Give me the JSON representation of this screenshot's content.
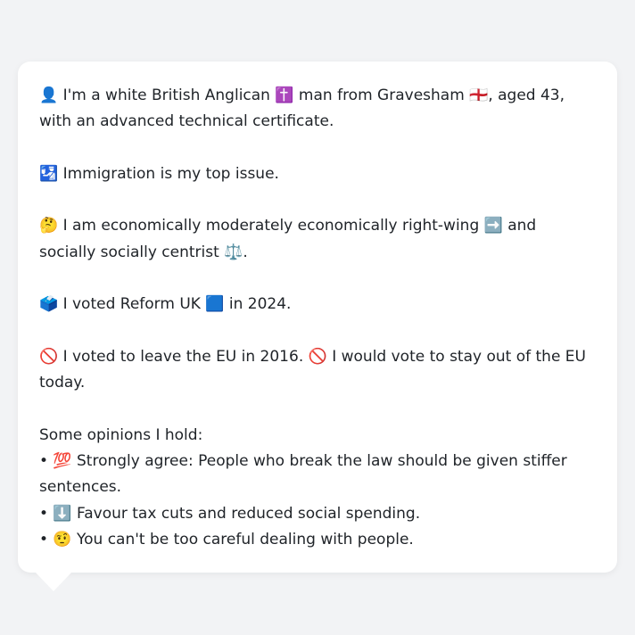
{
  "profile": {
    "identity": "👤 I'm a white British Anglican ✝️ man from Gravesham 🏴󠁧󠁢󠁥󠁮󠁧󠁿, aged 43, with an advanced technical certificate.",
    "top_issue": "🛂 Immigration is my top issue.",
    "ideology": "🤔 I am economically moderately economically right-wing ➡️ and socially socially centrist ⚖️.",
    "vote_2024": "🗳️ I voted Reform UK 🟦 in 2024.",
    "eu": "🚫 I voted to leave the EU in 2016. 🚫 I would vote to stay out of the EU today.",
    "opinions_heading": "Some opinions I hold:",
    "opinions": [
      "• 💯 Strongly agree: People who break the law should be given stiffer sentences.",
      "• ⬇️ Favour tax cuts and reduced social spending.",
      "• 🤨 You can't be too careful dealing with people."
    ]
  }
}
